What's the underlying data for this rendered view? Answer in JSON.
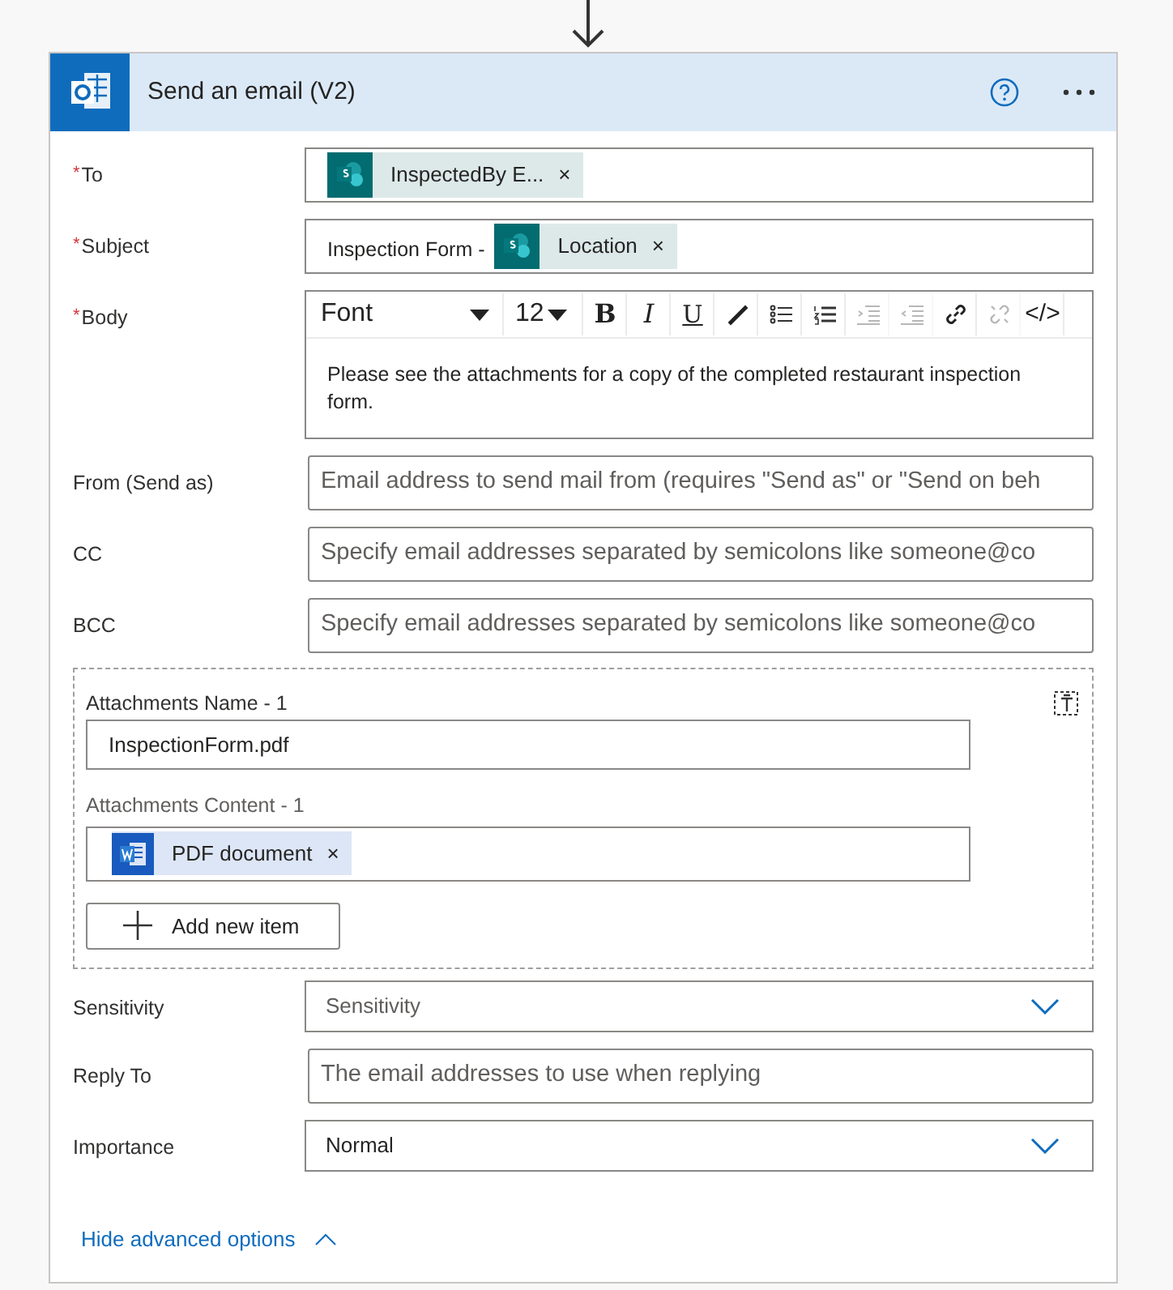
{
  "card": {
    "title": "Send an email (V2)"
  },
  "fields": [
    {
      "kind": "tokens",
      "label": "To",
      "required_mark": "*",
      "tokens": [
        {
          "kind": "sharepoint",
          "label": "InspectedBy E...",
          "remove": "×"
        }
      ]
    },
    {
      "kind": "tokens",
      "label": "Subject",
      "required_mark": "*",
      "prefix": "Inspection Form -",
      "tokens": [
        {
          "kind": "sharepoint",
          "label": "Location",
          "remove": "×"
        }
      ]
    },
    {
      "kind": "rich",
      "label": "Body",
      "required_mark": "*",
      "font": "Font",
      "size": "12",
      "tools": [
        {
          "kind": "bold",
          "glyph": "B",
          "disabled": false
        },
        {
          "kind": "italic",
          "glyph": "I",
          "disabled": false
        },
        {
          "kind": "underline",
          "glyph": "U",
          "disabled": false
        },
        {
          "kind": "pen",
          "disabled": false
        },
        {
          "kind": "bullets",
          "disabled": false
        },
        {
          "kind": "numbers",
          "disabled": false
        },
        {
          "kind": "indent",
          "disabled": true
        },
        {
          "kind": "outdent",
          "disabled": true
        },
        {
          "kind": "link",
          "disabled": false
        },
        {
          "kind": "unlink",
          "disabled": true
        },
        {
          "kind": "code",
          "glyph": "</>",
          "disabled": false
        }
      ],
      "value": "Please see the attachments for a copy of the completed restaurant inspection form."
    },
    {
      "kind": "text",
      "label": "From (Send as)",
      "placeholder": "Email address to send mail from (requires \"Send as\" or \"Send on beh"
    },
    {
      "kind": "text",
      "label": "CC",
      "placeholder": "Specify email addresses separated by semicolons like someone@co"
    },
    {
      "kind": "text",
      "label": "BCC",
      "placeholder": "Specify email addresses separated by semicolons like someone@co"
    }
  ],
  "attachments": {
    "name_label": "Attachments Name - 1",
    "name_value": "InspectionForm.pdf",
    "content_label": "Attachments Content - 1",
    "tokens": [
      {
        "kind": "word",
        "label": "PDF document",
        "remove": "×"
      }
    ],
    "add_button": "Add new item"
  },
  "fields2": [
    {
      "kind": "dropdown",
      "label": "Sensitivity",
      "placeholder": "Sensitivity"
    },
    {
      "kind": "text",
      "label": "Reply To",
      "placeholder": "The email addresses to use when replying"
    },
    {
      "kind": "dropdown",
      "label": "Importance",
      "value": "Normal"
    }
  ],
  "advanced": {
    "label": "Hide advanced options",
    "expanded": true
  }
}
